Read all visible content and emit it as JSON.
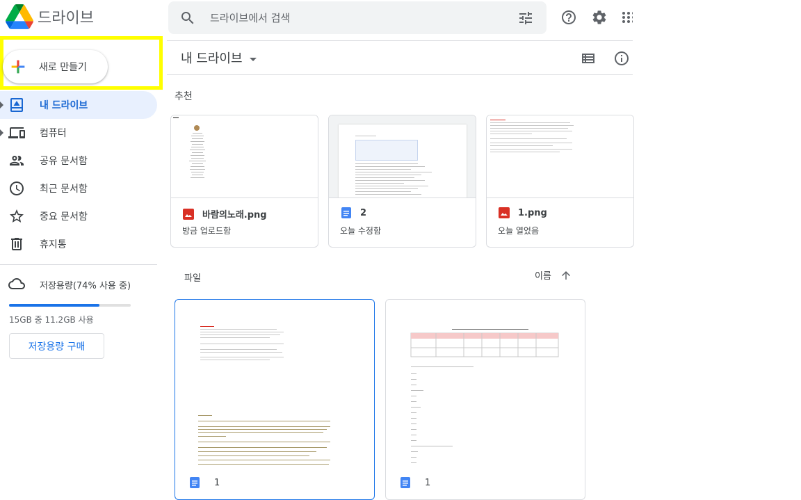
{
  "app": {
    "title": "드라이브"
  },
  "search": {
    "placeholder": "드라이브에서 검색"
  },
  "header_icons": [
    "help-icon",
    "settings-icon",
    "apps-icon"
  ],
  "sidebar": {
    "new_label": "새로 만들기",
    "items": [
      {
        "label": "내 드라이브",
        "icon": "my-drive-icon",
        "active": true
      },
      {
        "label": "컴퓨터",
        "icon": "computers-icon"
      },
      {
        "label": "공유 문서함",
        "icon": "shared-icon"
      },
      {
        "label": "최근 문서함",
        "icon": "recent-icon"
      },
      {
        "label": "중요 문서함",
        "icon": "starred-icon"
      },
      {
        "label": "휴지통",
        "icon": "trash-icon"
      }
    ],
    "storage": {
      "label": "저장용량(74% 사용 중)",
      "used_fraction": 0.74,
      "usage": "15GB 중 11.2GB 사용",
      "buy_label": "저장용량 구매"
    }
  },
  "main": {
    "breadcrumb": "내 드라이브",
    "suggested_label": "추천",
    "suggested": [
      {
        "name": "바람의노래.png",
        "sub": "방금 업로드함",
        "icon": "image-file-icon"
      },
      {
        "name": "2",
        "sub": "오늘 수정함",
        "icon": "docs-file-icon"
      },
      {
        "name": "1.png",
        "sub": "오늘 열었음",
        "icon": "image-file-icon"
      }
    ],
    "files_label": "파일",
    "sort_label": "이름",
    "files": [
      {
        "name": "1",
        "icon": "docs-file-icon",
        "selected": true
      },
      {
        "name": "1",
        "icon": "docs-file-icon",
        "selected": false
      }
    ]
  },
  "colors": {
    "accent": "#1a73e8",
    "active_bg": "#e8f0fe",
    "highlight": "#ffff00",
    "image_icon": "#d93025",
    "docs_icon": "#4285f4"
  }
}
